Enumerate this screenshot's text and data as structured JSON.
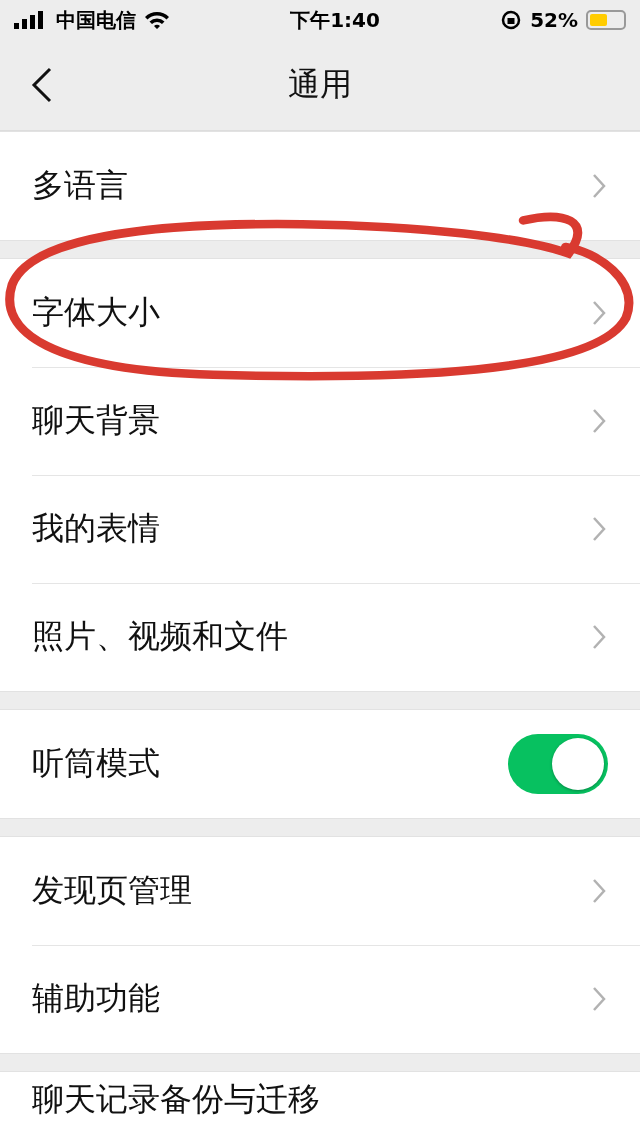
{
  "status_bar": {
    "carrier": "中国电信",
    "time": "下午1:40",
    "battery": "52%"
  },
  "nav": {
    "title": "通用"
  },
  "groups": [
    {
      "items": [
        {
          "kind": "link",
          "label": "多语言",
          "circled": false
        }
      ]
    },
    {
      "items": [
        {
          "kind": "link",
          "label": "字体大小",
          "circled": true
        },
        {
          "kind": "link",
          "label": "聊天背景",
          "circled": false
        },
        {
          "kind": "link",
          "label": "我的表情",
          "circled": false
        },
        {
          "kind": "link",
          "label": "照片、视频和文件",
          "circled": false
        }
      ]
    },
    {
      "items": [
        {
          "kind": "toggle",
          "label": "听筒模式",
          "on": true
        }
      ]
    },
    {
      "items": [
        {
          "kind": "link",
          "label": "发现页管理",
          "circled": false
        },
        {
          "kind": "link",
          "label": "辅助功能",
          "circled": false
        }
      ]
    },
    {
      "items": [
        {
          "kind": "partial",
          "label": "聊天记录备份与迁移"
        }
      ]
    }
  ]
}
